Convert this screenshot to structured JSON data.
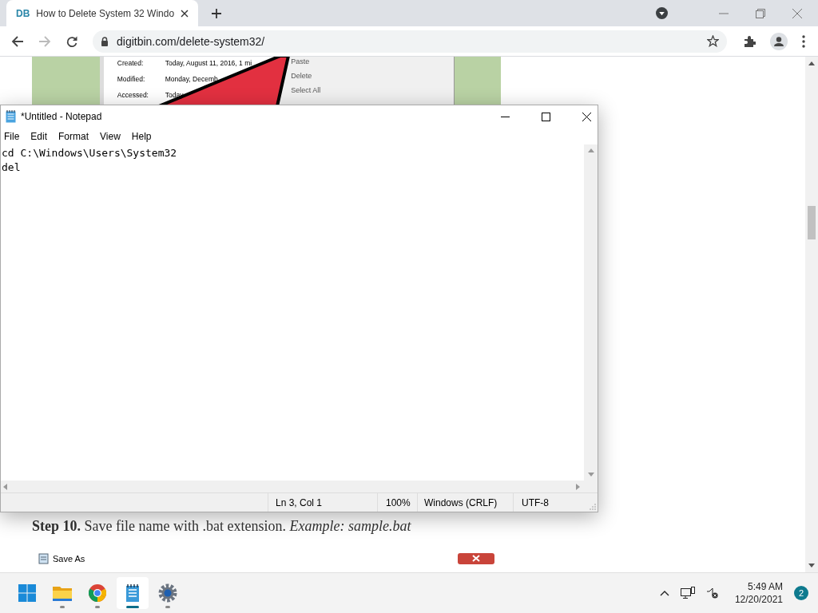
{
  "browser": {
    "tab": {
      "favicon": "DB",
      "title": "How to Delete System 32 Windo",
      "selected": true
    },
    "url": "digitbin.com/delete-system32/"
  },
  "article": {
    "figure": {
      "properties": [
        {
          "label": "Created:",
          "value": "Today, August 11, 2016, 1 mi"
        },
        {
          "label": "Modified:",
          "value": "Monday, Decemb"
        },
        {
          "label": "Accessed:",
          "value": "Today"
        }
      ],
      "menu_items": [
        "Paste",
        "Delete",
        "Select All"
      ]
    },
    "step": "**Step 10.** Save file name with .bat extension. *Example: sample.bat*",
    "next_figure": {
      "title": "Save As"
    }
  },
  "notepad": {
    "title": "*Untitled - Notepad",
    "menu": [
      "File",
      "Edit",
      "Format",
      "View",
      "Help"
    ],
    "lines": [
      "cd C:\\Windows\\Users\\System32",
      "del"
    ],
    "status": [
      "Ln 3, Col 1",
      "100%",
      "Windows (CRLF)",
      "UTF-8"
    ]
  },
  "taskbar": {
    "apps": [
      {
        "kind": "start",
        "running": false,
        "selected": false
      },
      {
        "kind": "files",
        "running": true,
        "selected": false
      },
      {
        "kind": "chrome",
        "running": true,
        "selected": false
      },
      {
        "kind": "notepad",
        "running": true,
        "selected": true
      },
      {
        "kind": "settings",
        "running": true,
        "selected": false
      }
    ],
    "time": "5:49 AM",
    "date": "12/20/2021",
    "notifications": "2"
  }
}
